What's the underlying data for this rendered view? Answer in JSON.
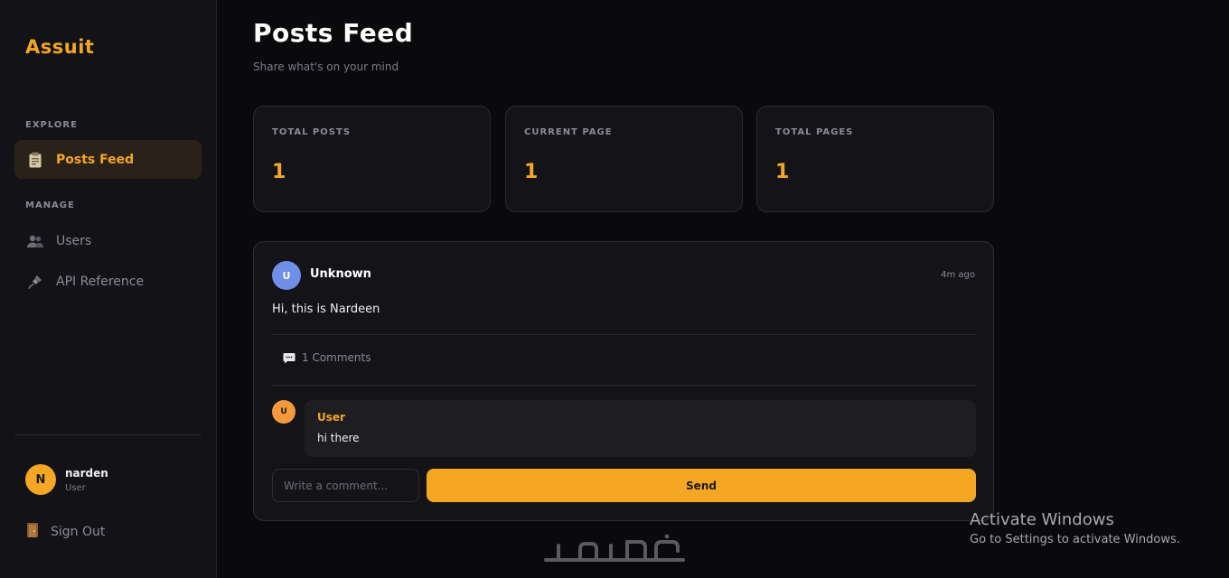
{
  "sidebar": {
    "brand": "Assuit",
    "sections": {
      "explore": "EXPLORE",
      "manage": "MANAGE"
    },
    "items": [
      {
        "label": "Posts Feed",
        "icon": "clipboard-icon",
        "active": true
      },
      {
        "label": "Users",
        "icon": "users-icon",
        "active": false
      },
      {
        "label": "API Reference",
        "icon": "plug-icon",
        "active": false
      }
    ],
    "profile": {
      "initial": "N",
      "name": "narden",
      "role": "User"
    },
    "sign_out": "Sign Out"
  },
  "main": {
    "title": "Posts Feed",
    "subtitle": "Share what's on your mind",
    "stats": [
      {
        "label": "TOTAL POSTS",
        "value": "1"
      },
      {
        "label": "CURRENT PAGE",
        "value": "1"
      },
      {
        "label": "TOTAL PAGES",
        "value": "1"
      }
    ],
    "post": {
      "avatar_initial": "U",
      "author": "Unknown",
      "time": "4m ago",
      "body": "Hi, this is Nardeen",
      "comments_label": "1 Comments",
      "comments": [
        {
          "avatar_initial": "U",
          "author": "User",
          "text": "hi there"
        }
      ],
      "comment_placeholder": "Write a comment...",
      "send_label": "Send"
    }
  },
  "os_overlay": {
    "activate_title": "Activate Windows",
    "activate_sub": "Go to Settings to activate Windows."
  },
  "colors": {
    "accent": "#f5a623",
    "background": "#0a0a0c",
    "sidebar": "#131317",
    "card": "#141418"
  }
}
